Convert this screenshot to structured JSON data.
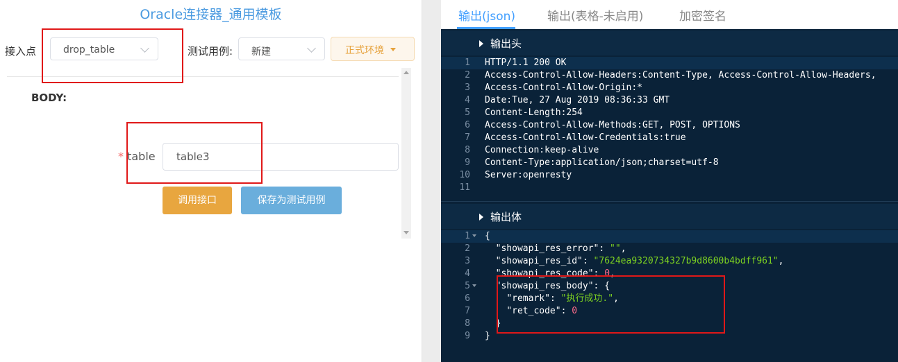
{
  "left": {
    "title": "Oracle连接器_通用模板",
    "endpoint_label": "接入点",
    "endpoint_value": "drop_table",
    "testcase_label": "测试用例:",
    "testcase_value": "新建",
    "env_button": "正式环境",
    "body_label": "BODY:",
    "required_mark": "*",
    "table_label": "table",
    "table_value": "table3",
    "call_button": "调用接口",
    "save_button": "保存为测试用例"
  },
  "tabs": [
    {
      "label": "输出(json)",
      "active": true
    },
    {
      "label": "输出(表格-未启用)",
      "active": false
    },
    {
      "label": "加密签名",
      "active": false
    }
  ],
  "headers_section": {
    "title": "输出头",
    "lines": [
      "HTTP/1.1 200 OK",
      "Access-Control-Allow-Headers:Content-Type, Access-Control-Allow-Headers,",
      "Access-Control-Allow-Origin:*",
      "Date:Tue, 27 Aug 2019 08:36:33 GMT",
      "Content-Length:254",
      "Access-Control-Allow-Methods:GET, POST, OPTIONS",
      "Access-Control-Allow-Credentials:true",
      "Connection:keep-alive",
      "Content-Type:application/json;charset=utf-8",
      "Server:openresty",
      ""
    ]
  },
  "body_section": {
    "title": "输出体",
    "lines": [
      "{",
      "  \"showapi_res_error\": \"\",",
      "  \"showapi_res_id\": \"7624ea9320734327b9d8600b4bdff961\",",
      "  \"showapi_res_code\": 0,",
      "  \"showapi_res_body\": {",
      "    \"remark\": \"执行成功.\",",
      "    \"ret_code\": 0",
      "  }",
      "}"
    ]
  },
  "colors": {
    "accent": "#409eff",
    "highlight_box": "#e01818",
    "code_bg": "#0a2238",
    "string": "#7ed321",
    "number": "#ff6b8b",
    "warn": "#e6a23c"
  }
}
